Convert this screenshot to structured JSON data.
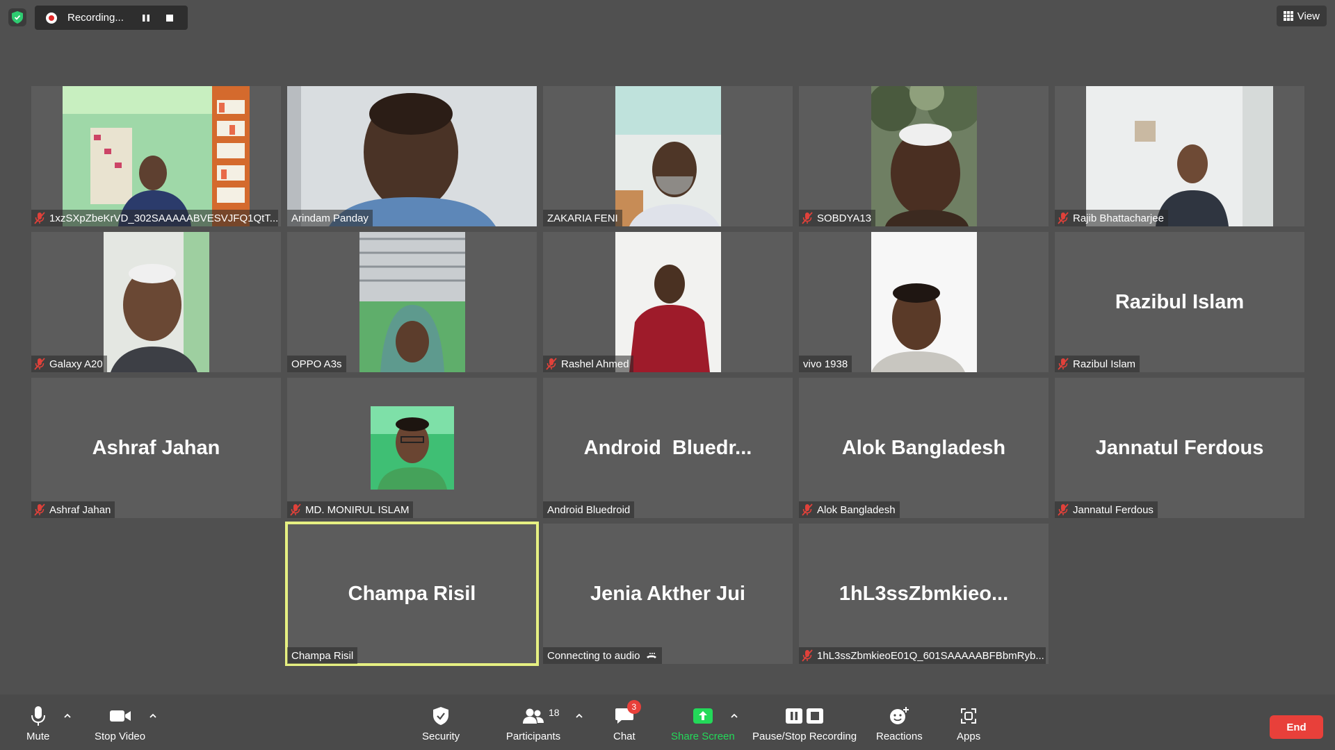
{
  "recording": {
    "label": "Recording..."
  },
  "view_button": {
    "label": "View"
  },
  "participants": [
    {
      "name": "1xzSXpZbeKrVD_302SAAAAABVESVJFQ1QtT...",
      "muted": true,
      "video": true
    },
    {
      "name": "Arindam Panday",
      "muted": false,
      "video": true
    },
    {
      "name": "ZAKARIA FENI",
      "muted": false,
      "video": true
    },
    {
      "name": "SOBDYA13",
      "muted": true,
      "video": true
    },
    {
      "name": "Rajib Bhattacharjee",
      "muted": true,
      "video": true
    },
    {
      "name": "Galaxy A20",
      "muted": true,
      "video": true
    },
    {
      "name": "OPPO A3s",
      "muted": false,
      "video": true
    },
    {
      "name": "Rashel Ahmed",
      "muted": true,
      "video": true
    },
    {
      "name": "vivo 1938",
      "muted": false,
      "video": true
    },
    {
      "name": "Razibul Islam",
      "display": "Razibul Islam",
      "muted": true,
      "video": false
    },
    {
      "name": "Ashraf Jahan",
      "display": "Ashraf Jahan",
      "muted": true,
      "video": false
    },
    {
      "name": "MD. MONIRUL ISLAM",
      "muted": true,
      "video": false,
      "avatar": true
    },
    {
      "name": "Android Bluedroid",
      "display": "Android  Bluedr...",
      "muted": false,
      "video": false
    },
    {
      "name": "Alok Bangladesh",
      "display": "Alok Bangladesh",
      "muted": true,
      "video": false
    },
    {
      "name": "Jannatul Ferdous",
      "display": "Jannatul Ferdous",
      "muted": true,
      "video": false
    },
    {
      "name": "Champa Risil",
      "display": "Champa Risil",
      "muted": false,
      "video": false,
      "active": true
    },
    {
      "name": "Connecting to audio",
      "display": "Jenia Akther Jui",
      "muted": false,
      "video": false,
      "connecting": true
    },
    {
      "name": "1hL3ssZbmkieoE01Q_601SAAAAABFBbmRyb...",
      "display": "1hL3ssZbmkieo...",
      "muted": true,
      "video": false
    }
  ],
  "toolbar": {
    "mute": "Mute",
    "stop_video": "Stop Video",
    "security": "Security",
    "participants": "Participants",
    "participants_count": "18",
    "chat": "Chat",
    "chat_badge": "3",
    "share_screen": "Share Screen",
    "pause_stop_recording": "Pause/Stop Recording",
    "reactions": "Reactions",
    "apps": "Apps",
    "end": "End"
  },
  "colors": {
    "background": "#505050",
    "tile": "#5c5c5c",
    "active_border": "#e6f082",
    "share_green": "#23d959",
    "end_red": "#e8403a",
    "muted_red": "#e0413a"
  }
}
